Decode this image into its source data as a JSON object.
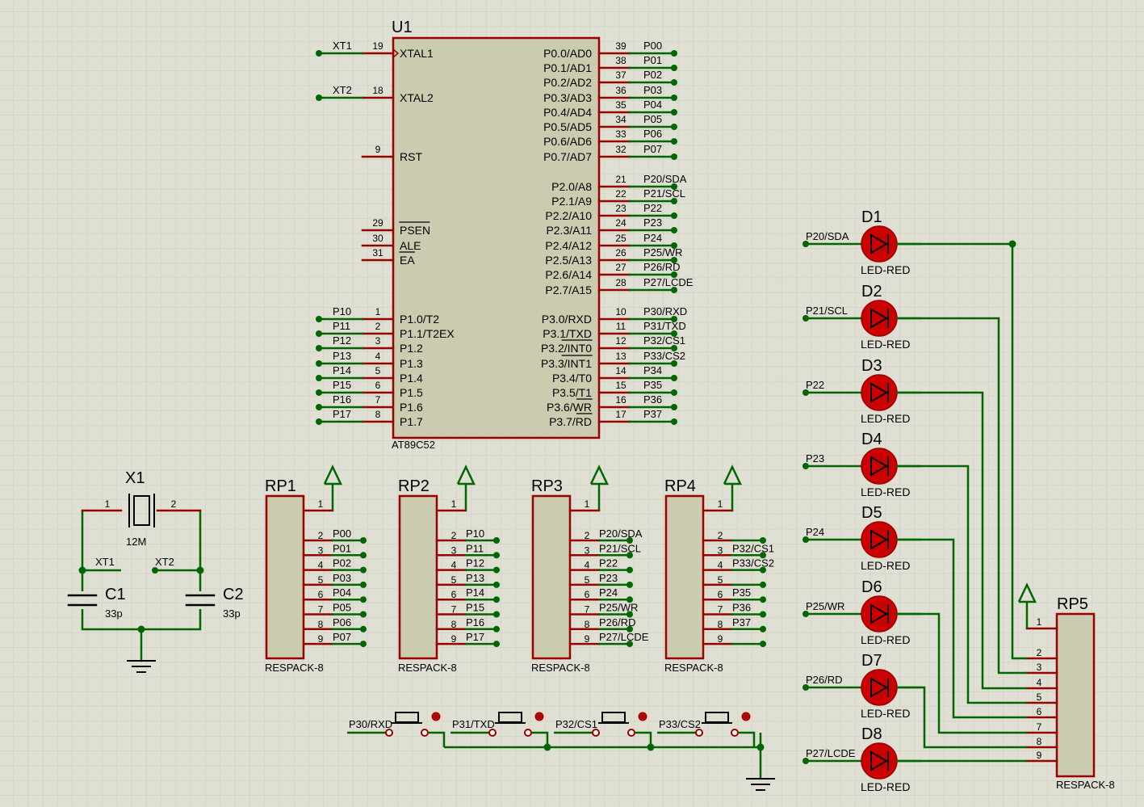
{
  "colors": {
    "background": "#dfdfd3",
    "grid": "#cbcbbf",
    "wire": "#006600",
    "pin": "#990000",
    "body_fill": "#cbcbb0",
    "body_stroke": "#990000",
    "led": "#cc0000",
    "text": "#000000"
  },
  "u1": {
    "ref": "U1",
    "part": "AT89C52",
    "left_pins": [
      {
        "num": "19",
        "name": "XTAL1",
        "net": "XT1",
        "clock": true
      },
      {
        "num": "18",
        "name": "XTAL2",
        "net": "XT2"
      },
      {
        "num": "9",
        "name": "RST",
        "net": ""
      },
      {
        "num": "29",
        "name": "PSEN",
        "net": "",
        "bar": true
      },
      {
        "num": "30",
        "name": "ALE",
        "net": ""
      },
      {
        "num": "31",
        "name": "EA",
        "net": "",
        "bar": true
      },
      {
        "num": "1",
        "name": "P1.0/T2",
        "net": "P10"
      },
      {
        "num": "2",
        "name": "P1.1/T2EX",
        "net": "P11"
      },
      {
        "num": "3",
        "name": "P1.2",
        "net": "P12"
      },
      {
        "num": "4",
        "name": "P1.3",
        "net": "P13"
      },
      {
        "num": "5",
        "name": "P1.4",
        "net": "P14"
      },
      {
        "num": "6",
        "name": "P1.5",
        "net": "P15"
      },
      {
        "num": "7",
        "name": "P1.6",
        "net": "P16"
      },
      {
        "num": "8",
        "name": "P1.7",
        "net": "P17"
      }
    ],
    "right_pins": [
      {
        "num": "39",
        "name": "P0.0/AD0",
        "net": "P00"
      },
      {
        "num": "38",
        "name": "P0.1/AD1",
        "net": "P01"
      },
      {
        "num": "37",
        "name": "P0.2/AD2",
        "net": "P02"
      },
      {
        "num": "36",
        "name": "P0.3/AD3",
        "net": "P03"
      },
      {
        "num": "35",
        "name": "P0.4/AD4",
        "net": "P04"
      },
      {
        "num": "34",
        "name": "P0.5/AD5",
        "net": "P05"
      },
      {
        "num": "33",
        "name": "P0.6/AD6",
        "net": "P06"
      },
      {
        "num": "32",
        "name": "P0.7/AD7",
        "net": "P07"
      },
      {
        "num": "21",
        "name": "P2.0/A8",
        "net": "P20/SDA"
      },
      {
        "num": "22",
        "name": "P2.1/A9",
        "net": "P21/SCL"
      },
      {
        "num": "23",
        "name": "P2.2/A10",
        "net": "P22"
      },
      {
        "num": "24",
        "name": "P2.3/A11",
        "net": "P23"
      },
      {
        "num": "25",
        "name": "P2.4/A12",
        "net": "P24"
      },
      {
        "num": "26",
        "name": "P2.5/A13",
        "net": "P25/WR"
      },
      {
        "num": "27",
        "name": "P2.6/A14",
        "net": "P26/RD"
      },
      {
        "num": "28",
        "name": "P2.7/A15",
        "net": "P27/LCDE"
      },
      {
        "num": "10",
        "name": "P3.0/RXD",
        "net": "P30/RXD"
      },
      {
        "num": "11",
        "name": "P3.1/TXD",
        "net": "P31/TXD"
      },
      {
        "num": "12",
        "name": "P3.2/INT0",
        "net": "P32/CS1",
        "bar": "INT0"
      },
      {
        "num": "13",
        "name": "P3.3/INT1",
        "net": "P33/CS2",
        "bar": "INT1"
      },
      {
        "num": "14",
        "name": "P3.4/T0",
        "net": "P34"
      },
      {
        "num": "15",
        "name": "P3.5/T1",
        "net": "P35"
      },
      {
        "num": "16",
        "name": "P3.6/WR",
        "net": "P36",
        "bar": "WR"
      },
      {
        "num": "17",
        "name": "P3.7/RD",
        "net": "P37",
        "bar": "RD"
      }
    ]
  },
  "crystal": {
    "ref": "X1",
    "value": "12M",
    "pin1": "1",
    "pin2": "2",
    "c1": {
      "ref": "C1",
      "value": "33p"
    },
    "c2": {
      "ref": "C2",
      "value": "33p"
    },
    "net_left": "XT1",
    "net_right": "XT2"
  },
  "respacks": [
    {
      "ref": "RP1",
      "part": "RESPACK-8",
      "pins": [
        "1",
        "2",
        "3",
        "4",
        "5",
        "6",
        "7",
        "8",
        "9"
      ],
      "nets": [
        "P00",
        "P01",
        "P02",
        "P03",
        "P04",
        "P05",
        "P06",
        "P07"
      ]
    },
    {
      "ref": "RP2",
      "part": "RESPACK-8",
      "pins": [
        "1",
        "2",
        "3",
        "4",
        "5",
        "6",
        "7",
        "8",
        "9"
      ],
      "nets": [
        "P10",
        "P11",
        "P12",
        "P13",
        "P14",
        "P15",
        "P16",
        "P17"
      ]
    },
    {
      "ref": "RP3",
      "part": "RESPACK-8",
      "pins": [
        "1",
        "2",
        "3",
        "4",
        "5",
        "6",
        "7",
        "8",
        "9"
      ],
      "nets": [
        "P20/SDA",
        "P21/SCL",
        "P22",
        "P23",
        "P24",
        "P25/WR",
        "P26/RD",
        "P27/LCDE"
      ]
    },
    {
      "ref": "RP4",
      "part": "RESPACK-8",
      "pins": [
        "1",
        "2",
        "3",
        "4",
        "5",
        "6",
        "7",
        "8",
        "9"
      ],
      "nets": [
        "",
        "P32/CS1",
        "P33/CS2",
        "",
        "P35",
        "P36",
        "P37",
        ""
      ]
    }
  ],
  "rp5": {
    "ref": "RP5",
    "part": "RESPACK-8",
    "pins": [
      "1",
      "2",
      "3",
      "4",
      "5",
      "6",
      "7",
      "8",
      "9"
    ]
  },
  "leds": [
    {
      "ref": "D1",
      "part": "LED-RED",
      "net": "P20/SDA"
    },
    {
      "ref": "D2",
      "part": "LED-RED",
      "net": "P21/SCL"
    },
    {
      "ref": "D3",
      "part": "LED-RED",
      "net": "P22"
    },
    {
      "ref": "D4",
      "part": "LED-RED",
      "net": "P23"
    },
    {
      "ref": "D5",
      "part": "LED-RED",
      "net": "P24"
    },
    {
      "ref": "D6",
      "part": "LED-RED",
      "net": "P25/WR"
    },
    {
      "ref": "D7",
      "part": "LED-RED",
      "net": "P26/RD"
    },
    {
      "ref": "D8",
      "part": "LED-RED",
      "net": "P27/LCDE"
    }
  ],
  "buttons": [
    {
      "net": "P30/RXD"
    },
    {
      "net": "P31/TXD"
    },
    {
      "net": "P32/CS1"
    },
    {
      "net": "P33/CS2"
    }
  ]
}
